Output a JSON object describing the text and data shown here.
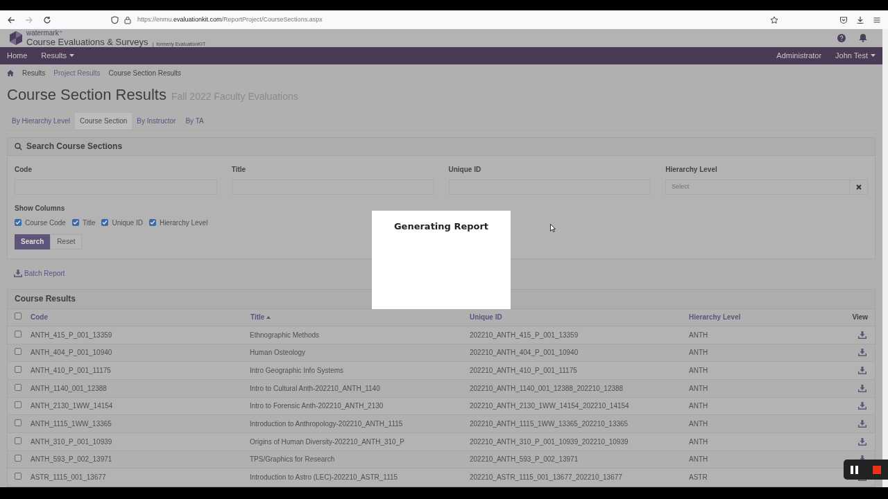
{
  "browser": {
    "url_scheme": "https://",
    "url_host": "enmu.",
    "url_domain": "evaluationkit.com",
    "url_path": "/ReportProject/CourseSections.aspx"
  },
  "header": {
    "brand_small": "watermark",
    "brand_tm": "™",
    "brand": "Course Evaluations & Surveys",
    "separator": "|",
    "formerly": "formerly EvaluationKIT"
  },
  "nav": {
    "left": [
      {
        "label": "Home",
        "dropdown": false
      },
      {
        "label": "Results",
        "dropdown": true
      }
    ],
    "right": [
      {
        "label": "Administrator",
        "dropdown": false
      },
      {
        "label": "John Test",
        "dropdown": true
      }
    ]
  },
  "breadcrumb": [
    "Results",
    "Project Results",
    "Course Section Results"
  ],
  "page_title": "Course Section Results",
  "page_subtitle": "Fall 2022 Faculty Evaluations",
  "tabs": [
    {
      "label": "By Hierarchy Level",
      "selected": false
    },
    {
      "label": "Course Section",
      "selected": true
    },
    {
      "label": "By Instructor",
      "selected": false
    },
    {
      "label": "By TA",
      "selected": false
    }
  ],
  "search_panel": {
    "title": "Search Course Sections",
    "fields": [
      {
        "label": "Code",
        "kind": "text"
      },
      {
        "label": "Title",
        "kind": "text"
      },
      {
        "label": "Unique ID",
        "kind": "text"
      },
      {
        "label": "Hierarchy Level",
        "kind": "select",
        "placeholder": "Select"
      }
    ],
    "show_columns_label": "Show Columns",
    "columns": [
      {
        "label": "Course Code",
        "checked": true
      },
      {
        "label": "Title",
        "checked": true
      },
      {
        "label": "Unique ID",
        "checked": true
      },
      {
        "label": "Hierarchy Level",
        "checked": true
      }
    ],
    "buttons": [
      "Search",
      "Reset"
    ]
  },
  "batch_report": "Batch Report",
  "results": {
    "title": "Course Results",
    "select_all_checked": false,
    "columns": [
      "Code",
      "Title",
      "Unique ID",
      "Hierarchy Level",
      "View"
    ],
    "rows": [
      {
        "code": "ANTH_415_P_001_13359",
        "title": "Ethnographic Methods",
        "unique_id": "202210_ANTH_415_P_001_13359",
        "level": "ANTH",
        "checked": false
      },
      {
        "code": "ANTH_404_P_001_10940",
        "title": "Human Osteology",
        "unique_id": "202210_ANTH_404_P_001_10940",
        "level": "ANTH",
        "checked": false
      },
      {
        "code": "ANTH_410_P_001_11175",
        "title": "Intro Geographic Info Systems",
        "unique_id": "202210_ANTH_410_P_001_11175",
        "level": "ANTH",
        "checked": false
      },
      {
        "code": "ANTH_1140_001_12388",
        "title": "Intro to Cultural Anth-202210_ANTH_1140",
        "unique_id": "202210_ANTH_1140_001_12388_202210_12388",
        "level": "ANTH",
        "checked": false
      },
      {
        "code": "ANTH_2130_1WW_14154",
        "title": "Intro to Forensic Anth-202210_ANTH_2130",
        "unique_id": "202210_ANTH_2130_1WW_14154_202210_14154",
        "level": "ANTH",
        "checked": false
      },
      {
        "code": "ANTH_1115_1WW_13365",
        "title": "Introduction to Anthropology-202210_ANTH_1115",
        "unique_id": "202210_ANTH_1115_1WW_13365_202210_13365",
        "level": "ANTH",
        "checked": false
      },
      {
        "code": "ANTH_310_P_001_10939",
        "title": "Origins of Human Diversity-202210_ANTH_310_P",
        "unique_id": "202210_ANTH_310_P_001_10939_202210_10939",
        "level": "ANTH",
        "checked": false
      },
      {
        "code": "ANTH_593_P_002_13971",
        "title": "TPS/Graphics for Research",
        "unique_id": "202210_ANTH_593_P_002_13971",
        "level": "ANTH",
        "checked": false
      },
      {
        "code": "ASTR_1115_001_13677",
        "title": "Introduction to Astro (LEC)-202210_ASTR_1115",
        "unique_id": "202210_ASTR_1115_001_13677_202210_13677",
        "level": "ASTR",
        "checked": false
      }
    ]
  },
  "modal": {
    "title": "Generating Report"
  }
}
